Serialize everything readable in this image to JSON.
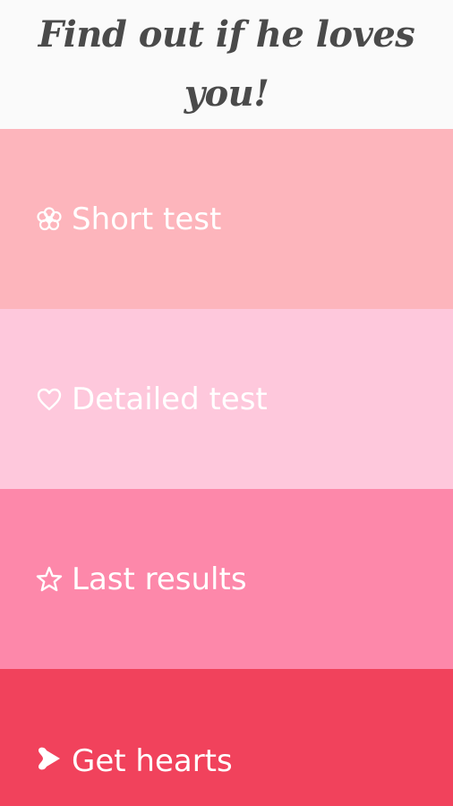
{
  "header": {
    "title": "Find out if he loves you!"
  },
  "colors": {
    "header_bg": "#fafafa",
    "title": "#4a4a4a",
    "short_test_bg": "#fdb5bc",
    "detailed_test_bg": "#fec8dc",
    "last_results_bg": "#fd88aa",
    "get_hearts_bg": "#f1425c",
    "menu_text": "#ffffff"
  },
  "menu": {
    "items": [
      {
        "label": "Short test",
        "icon": "flower-icon"
      },
      {
        "label": "Detailed test",
        "icon": "heart-outline-icon"
      },
      {
        "label": "Last results",
        "icon": "star-outline-icon"
      },
      {
        "label": "Get hearts",
        "icon": "heart-arrow-icon"
      }
    ]
  }
}
